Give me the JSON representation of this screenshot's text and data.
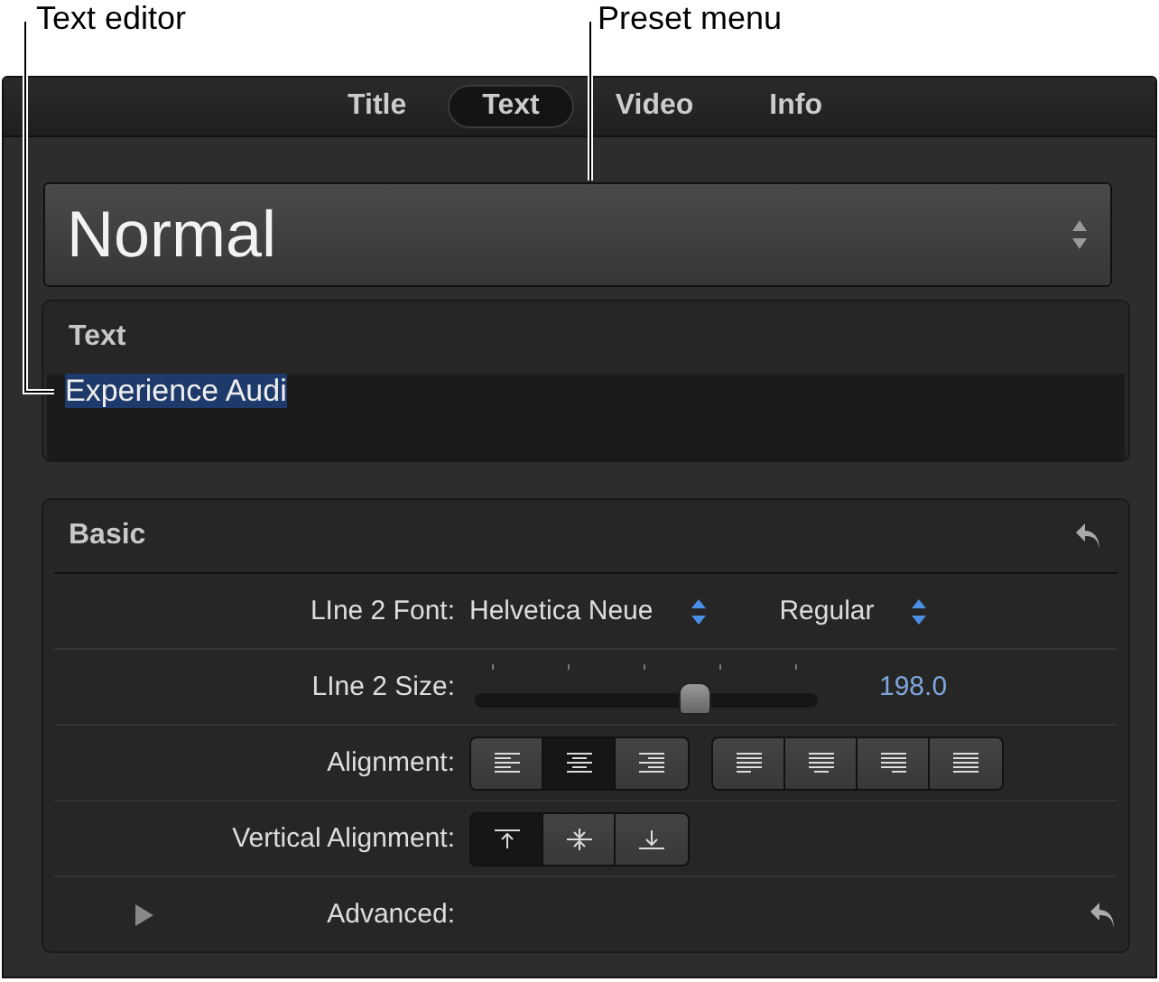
{
  "callouts": [
    {
      "label": "Text editor"
    },
    {
      "label": "Preset menu"
    }
  ],
  "tabs": [
    {
      "label": "Title",
      "selected": false
    },
    {
      "label": "Text",
      "selected": true
    },
    {
      "label": "Video",
      "selected": false
    },
    {
      "label": "Info",
      "selected": false
    }
  ],
  "preset_menu": {
    "value": "Normal"
  },
  "text_section": {
    "title": "Text",
    "value": "Experience Audi",
    "selected": true
  },
  "basic": {
    "title": "Basic",
    "rows": [
      {
        "kind": "font",
        "label": "LIne 2 Font:",
        "family": "Helvetica Neue",
        "style": "Regular"
      },
      {
        "kind": "slider",
        "label": "LIne 2 Size:",
        "level": 0.64,
        "reading": "198.0"
      },
      {
        "kind": "align",
        "label": "Alignment:",
        "groups": [
          [
            {
              "selected": false
            },
            {
              "selected": true
            },
            {
              "selected": false
            }
          ],
          [
            {
              "selected": false
            },
            {
              "selected": false
            },
            {
              "selected": false
            },
            {
              "selected": false
            }
          ]
        ]
      },
      {
        "kind": "valign",
        "label": "Vertical Alignment:",
        "groups": [
          [
            {
              "selected": true
            },
            {
              "selected": false
            },
            {
              "selected": false
            }
          ]
        ]
      },
      {
        "kind": "disclosure",
        "label": "Advanced:",
        "expanded": false
      }
    ]
  }
}
